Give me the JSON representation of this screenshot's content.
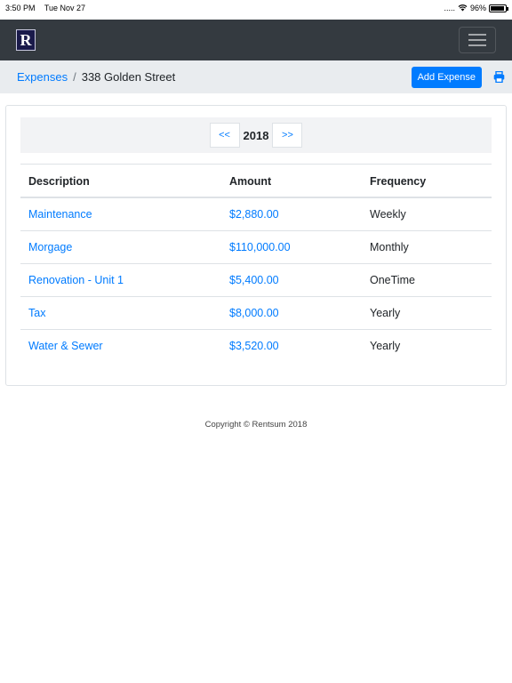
{
  "status": {
    "time": "3:50 PM",
    "date": "Tue Nov 27",
    "signal": ".....",
    "battery": "96%",
    "battery_level": 0.96
  },
  "navbar": {
    "logo_letter": "R",
    "menu_icon": "hamburger-icon"
  },
  "breadcrumb": {
    "parent": "Expenses",
    "separator": "/",
    "current": "338 Golden Street"
  },
  "actions": {
    "add_label": "Add Expense",
    "print_icon": "print-icon"
  },
  "pager": {
    "prev": "<<",
    "year": "2018",
    "next": ">>"
  },
  "table": {
    "headers": [
      "Description",
      "Amount",
      "Frequency"
    ],
    "rows": [
      {
        "description": "Maintenance",
        "amount": "$2,880.00",
        "frequency": "Weekly"
      },
      {
        "description": "Morgage",
        "amount": "$110,000.00",
        "frequency": "Monthly"
      },
      {
        "description": "Renovation - Unit 1",
        "amount": "$5,400.00",
        "frequency": "OneTime"
      },
      {
        "description": "Tax",
        "amount": "$8,000.00",
        "frequency": "Yearly"
      },
      {
        "description": "Water & Sewer",
        "amount": "$3,520.00",
        "frequency": "Yearly"
      }
    ]
  },
  "footer": {
    "text": "Copyright © Rentsum 2018"
  },
  "colors": {
    "accent": "#007bff",
    "navbar": "#343a40",
    "breadcrumb_bg": "#e9ecef"
  }
}
